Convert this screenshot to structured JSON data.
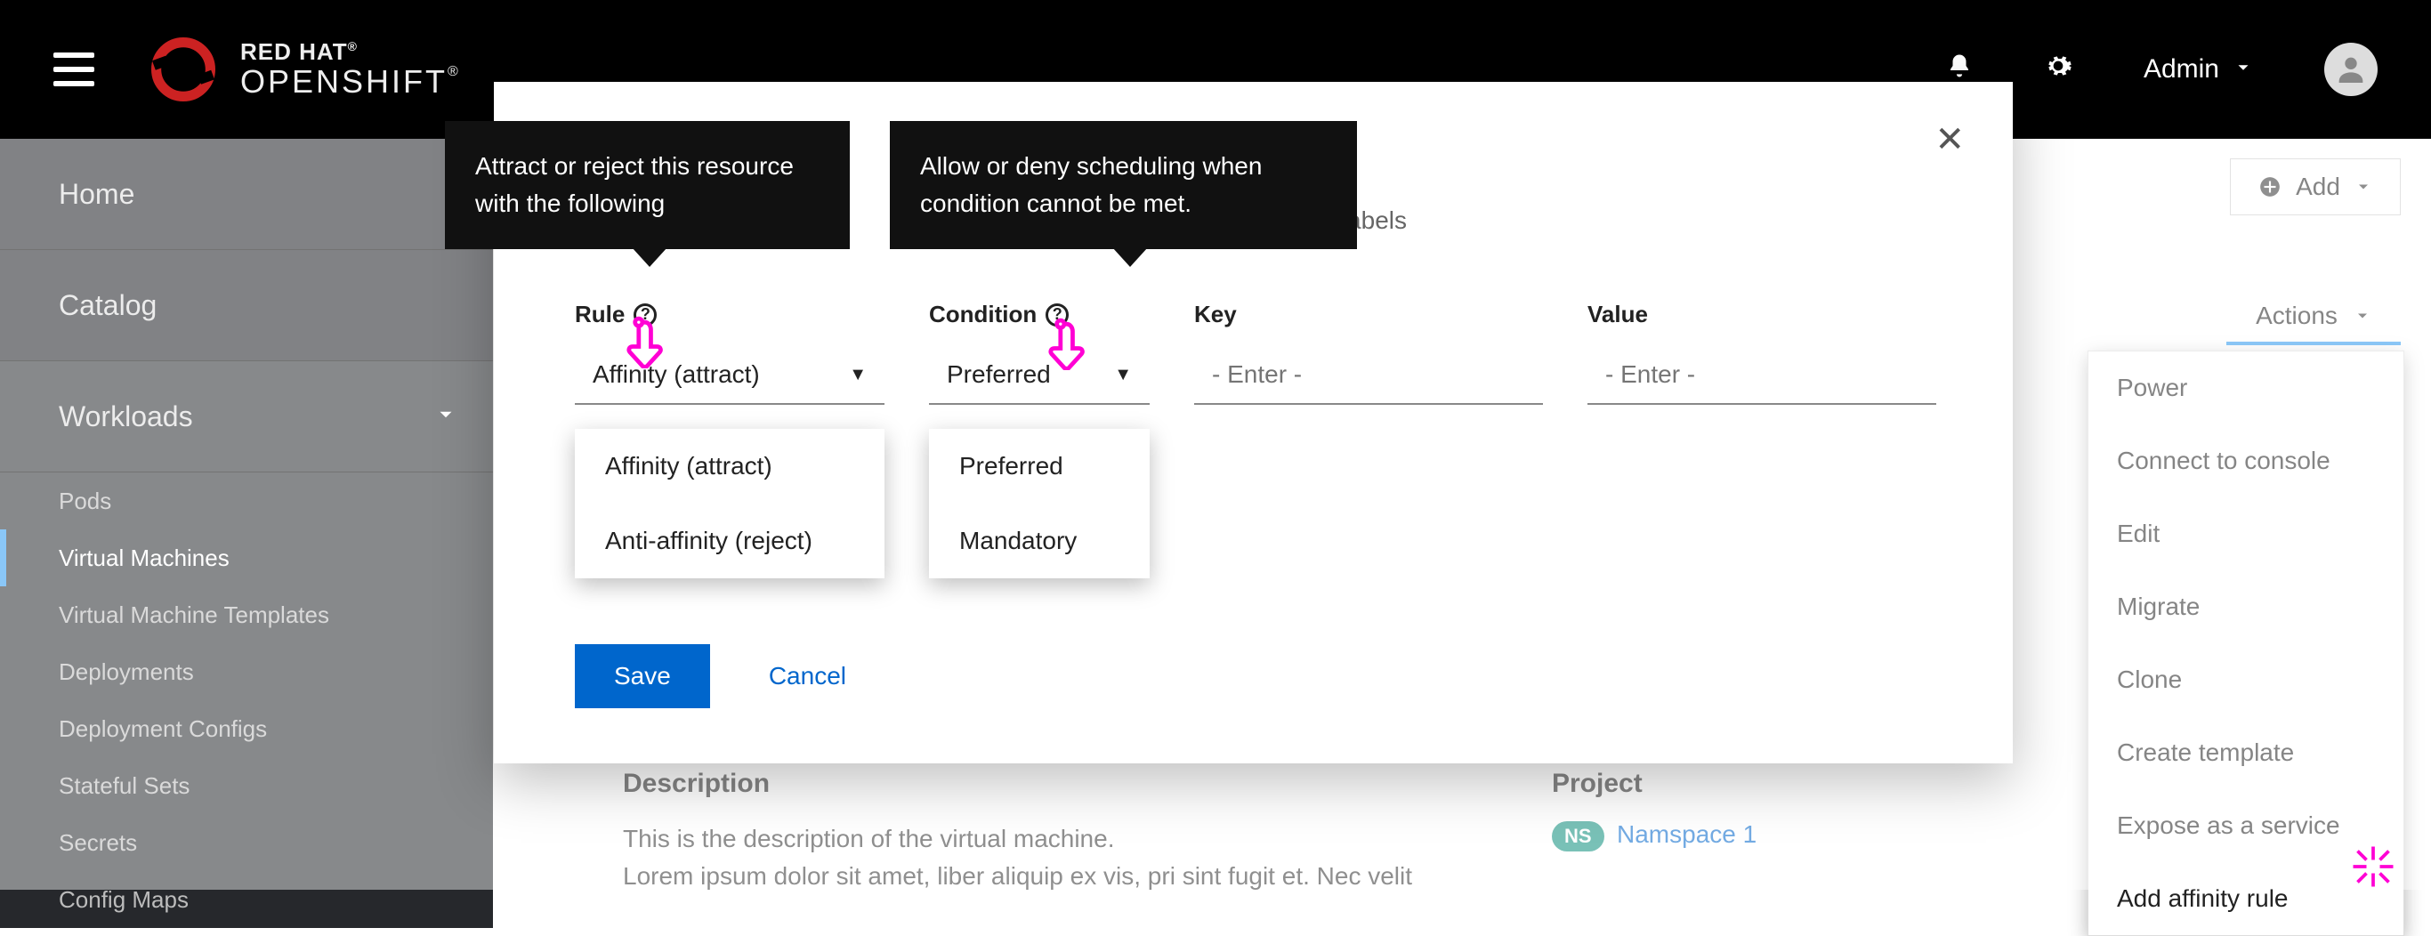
{
  "masthead": {
    "brand_line1": "RED HAT",
    "brand_line2": "OPENSHIFT",
    "user_label": "Admin"
  },
  "sidebar": {
    "top": [
      "Home",
      "Catalog",
      "Workloads"
    ],
    "sub": [
      "Pods",
      "Virtual Machines",
      "Virtual Machine Templates",
      "Deployments",
      "Deployment Configs",
      "Stateful Sets",
      "Secrets",
      "Config Maps"
    ]
  },
  "page_bg": {
    "add_label": "Add",
    "actions_label": "Actions",
    "desc_heading": "Description",
    "desc_line1": "This is the description of the virtual machine.",
    "desc_line2": "Lorem ipsum dolor sit amet, liber aliquip ex vis, pri sint fugit et. Nec velit",
    "proj_heading": "Project",
    "ns_badge": "NS",
    "ns_link": "Namspace 1"
  },
  "actions_menu": [
    "Power",
    "Connect to console",
    "Edit",
    "Migrate",
    "Clone",
    "Create template",
    "Expose as a service",
    "Add affinity rule"
  ],
  "modal": {
    "hint_suffix": "ources with the following labels",
    "labels": {
      "rule": "Rule",
      "condition": "Condition",
      "key": "Key",
      "value": "Value"
    },
    "rule_selected": "Affinity (attract)",
    "condition_selected": "Preferred",
    "key_placeholder": "- Enter -",
    "value_placeholder": "- Enter -",
    "rule_options": [
      "Affinity (attract)",
      "Anti-affinity (reject)"
    ],
    "condition_options": [
      "Preferred",
      "Mandatory"
    ],
    "save": "Save",
    "cancel": "Cancel"
  },
  "tooltips": {
    "rule": "Attract or reject this resource with the following",
    "condition": "Allow or deny scheduling when condition cannot be met."
  }
}
